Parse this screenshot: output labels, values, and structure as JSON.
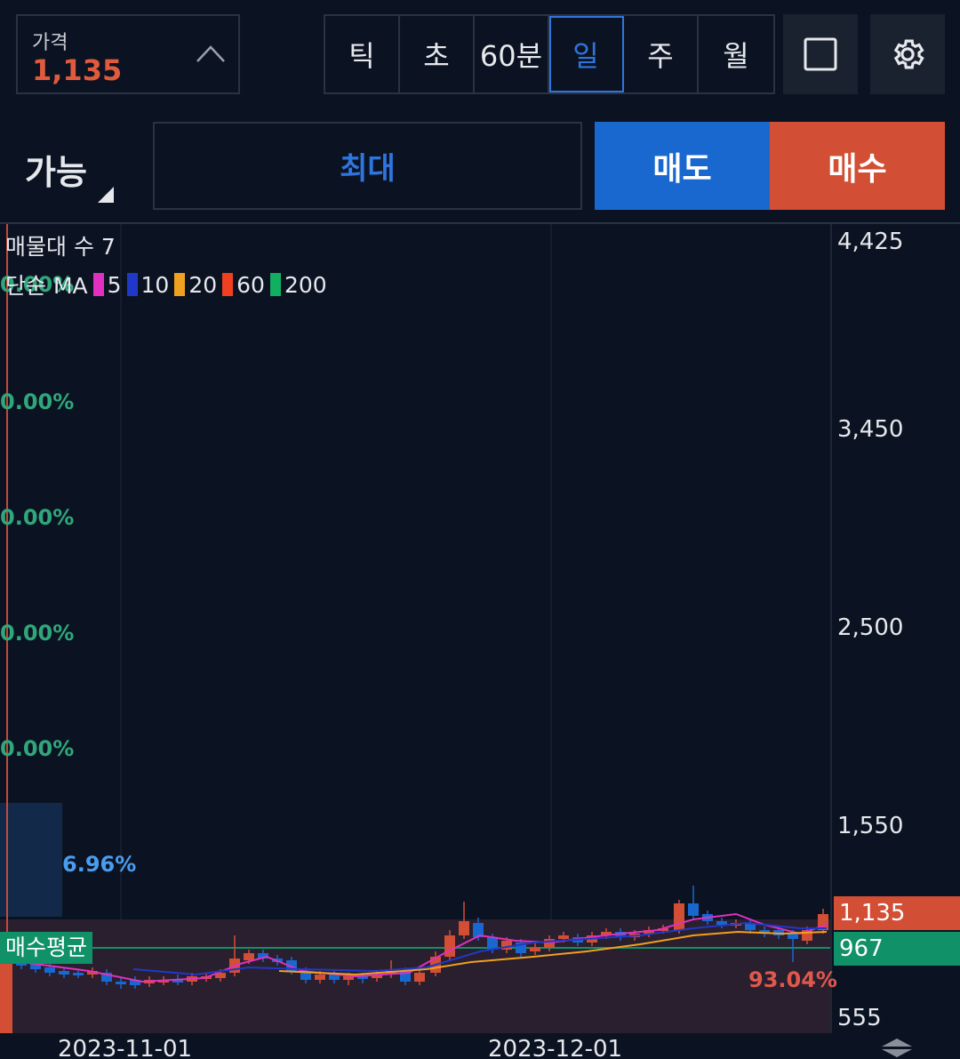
{
  "price": {
    "label": "가격",
    "value": "1,135"
  },
  "timeframes": [
    "틱",
    "초",
    "60분",
    "일",
    "주",
    "월"
  ],
  "active_timeframe": "일",
  "order": {
    "available": "가능",
    "max": "최대",
    "sell": "매도",
    "buy": "매수"
  },
  "indicators": {
    "volume_profile": "매물대 수 7",
    "ma_label": "단순 MA",
    "ma_periods": [
      {
        "period": "5",
        "color": "#e030c0"
      },
      {
        "period": "10",
        "color": "#2038c8"
      },
      {
        "period": "20",
        "color": "#f0a020"
      },
      {
        "period": "60",
        "color": "#f04020"
      },
      {
        "period": "200",
        "color": "#10b060"
      }
    ]
  },
  "profile_pcts": [
    "0.00%",
    "0.00%",
    "0.00%",
    "0.00%",
    "0.00%",
    "0.00%"
  ],
  "profile_highlight": "6.96%",
  "profile_bottom": "93.04%",
  "avg_buy_label": "매수평균",
  "y_axis": [
    "4,425",
    "3,450",
    "2,500",
    "1,550",
    "555"
  ],
  "current_price_tag": "1,135",
  "avg_price_tag": "967",
  "x_axis": [
    "2023-11-01",
    "2023-12-01"
  ],
  "colors": {
    "up": "#d24e34",
    "down": "#1968d0",
    "accent": "#2f75e0",
    "avg": "#109167"
  }
}
